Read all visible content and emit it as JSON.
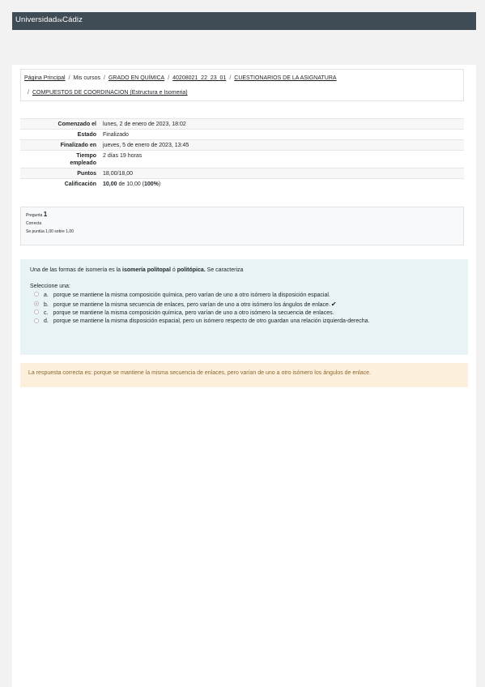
{
  "header": {
    "brand_prefix": "Universidad",
    "brand_de": "de",
    "brand_suffix": "Cádiz"
  },
  "breadcrumb": {
    "items": [
      "Página Principal",
      "Mis cursos",
      "GRADO EN QUÍMICA",
      "40208021_22_23_01",
      "CUESTIONARIOS DE LA ASIGNATURA",
      "COMPUESTOS DE COORDINACION (Estructura e Isomeria)"
    ],
    "separator": "/"
  },
  "summary": {
    "rows": [
      {
        "label": "Comenzado el",
        "value": "lunes, 2 de enero de 2023, 18:02"
      },
      {
        "label": "Estado",
        "value": "Finalizado"
      },
      {
        "label": "Finalizado en",
        "value": "jueves, 5 de enero de 2023, 13:45"
      },
      {
        "label_line1": "Tiempo",
        "label_line2": "empleado",
        "value": "2 días 19 horas"
      },
      {
        "label": "Puntos",
        "value": "18,00/18,00"
      },
      {
        "label": "Calificación",
        "grade_bold": "10,00",
        "grade_mid": " de 10,00 (",
        "grade_pct": "100%",
        "grade_end": ")"
      }
    ]
  },
  "question": {
    "label": "Pregunta",
    "number": "1",
    "status": "Correcta",
    "score": "Se puntúa 1,00 sobre 1,00",
    "text_start": "Una de las formas de isomería es la ",
    "text_bold1": "isomería politopal",
    "text_mid": " ó ",
    "text_bold2": "politópica.",
    "text_end": " Se caracteriza",
    "prompt": "Seleccione una:",
    "answers": [
      {
        "letter": "a.",
        "text": "porque se mantiene la misma composición química, pero varían de uno a otro isómero la disposición espacial.",
        "checked": false
      },
      {
        "letter": "b.",
        "text": "porque se mantiene la misma secuencia de enlaces, pero varían de uno a otro isómero los ángulos de enlace.",
        "checked": true
      },
      {
        "letter": "c.",
        "text": "porque se mantiene la misma composición química, pero varían de uno a otro isómero la secuencia de enlaces.",
        "checked": false
      },
      {
        "letter": "d.",
        "text": "porque se mantiene la misma disposición espacial, pero un isómero respecto de otro guardan una relación izquierda-derecha.",
        "checked": false
      }
    ],
    "checkmark": "✔"
  },
  "feedback": {
    "text": "La respuesta correcta es: porque se mantiene la misma secuencia de enlaces, pero varían de uno a otro isómero los ángulos de enlace."
  }
}
